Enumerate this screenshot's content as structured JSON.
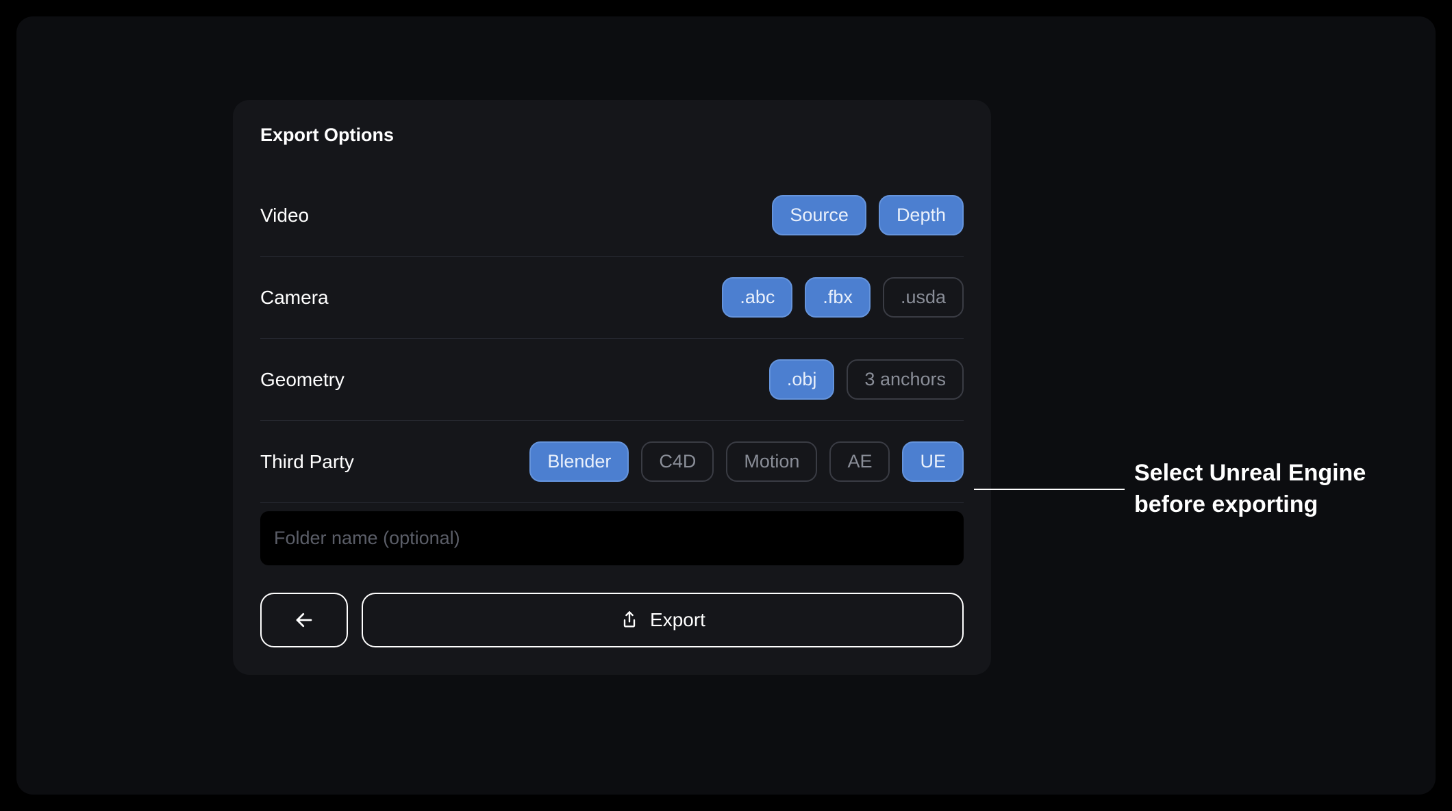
{
  "panel": {
    "title": "Export Options",
    "rows": {
      "video": {
        "label": "Video",
        "options": [
          {
            "label": "Source",
            "selected": true
          },
          {
            "label": "Depth",
            "selected": true
          }
        ]
      },
      "camera": {
        "label": "Camera",
        "options": [
          {
            "label": ".abc",
            "selected": true
          },
          {
            "label": ".fbx",
            "selected": true
          },
          {
            "label": ".usda",
            "selected": false
          }
        ]
      },
      "geometry": {
        "label": "Geometry",
        "options": [
          {
            "label": ".obj",
            "selected": true
          },
          {
            "label": "3 anchors",
            "selected": false
          }
        ]
      },
      "third_party": {
        "label": "Third Party",
        "options": [
          {
            "label": "Blender",
            "selected": true
          },
          {
            "label": "C4D",
            "selected": false
          },
          {
            "label": "Motion",
            "selected": false
          },
          {
            "label": "AE",
            "selected": false
          },
          {
            "label": "UE",
            "selected": true
          }
        ]
      }
    },
    "folder_input": {
      "placeholder": "Folder name (optional)",
      "value": ""
    },
    "export_button_label": "Export"
  },
  "annotation": {
    "line1": "Select Unreal Engine",
    "line2": "before exporting"
  }
}
